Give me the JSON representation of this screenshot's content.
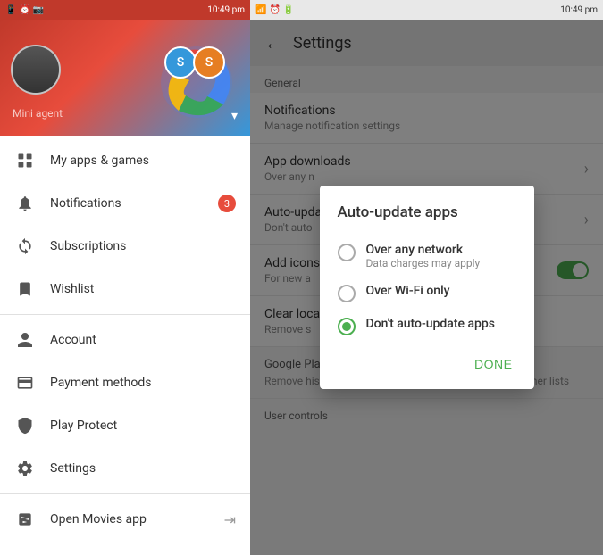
{
  "statusBar": {
    "left": {
      "time": "10:49 pm",
      "icons": [
        "signal",
        "wifi",
        "battery"
      ]
    },
    "right": {
      "time": "10:49 pm",
      "icons": [
        "signal",
        "wifi",
        "battery"
      ]
    }
  },
  "drawer": {
    "header": {
      "userName": "Mini agent",
      "initials1": "S",
      "initials2": "S"
    },
    "menu": [
      {
        "id": "my-apps",
        "label": "My apps & games",
        "icon": "grid"
      },
      {
        "id": "notifications",
        "label": "Notifications",
        "icon": "bell",
        "badge": "3"
      },
      {
        "id": "subscriptions",
        "label": "Subscriptions",
        "icon": "refresh"
      },
      {
        "id": "wishlist",
        "label": "Wishlist",
        "icon": "bookmark"
      },
      {
        "id": "account",
        "label": "Account",
        "icon": "person"
      },
      {
        "id": "payment",
        "label": "Payment methods",
        "icon": "credit-card"
      },
      {
        "id": "protect",
        "label": "Play Protect",
        "icon": "shield"
      },
      {
        "id": "settings",
        "label": "Settings",
        "icon": "settings"
      },
      {
        "id": "movies",
        "label": "Open Movies app",
        "icon": "film",
        "arrow": true
      }
    ]
  },
  "settings": {
    "title": "Settings",
    "sections": [
      {
        "label": "General",
        "items": [
          {
            "title": "Notifications",
            "subtitle": "Manage notification settings",
            "type": "arrow"
          },
          {
            "title": "App downloads",
            "subtitle": "Over any n",
            "type": "arrow"
          },
          {
            "title": "Auto-update apps",
            "subtitle": "Don't auto",
            "type": "arrow"
          },
          {
            "title": "Add icons",
            "subtitle": "For new a",
            "type": "toggle",
            "toggleOn": true
          },
          {
            "title": "Clear loca",
            "subtitle": "Remove s",
            "type": "text"
          }
        ]
      },
      {
        "label": "Google Play preferences",
        "labelFull": "Google Play preferences",
        "subtitle": "Remove history in your wishlist, the Beta program and other lists",
        "items": []
      },
      {
        "label": "User controls",
        "items": []
      }
    ]
  },
  "modal": {
    "title": "Auto-update apps",
    "options": [
      {
        "id": "over-any-network",
        "label": "Over any network",
        "sublabel": "Data charges may apply",
        "selected": false
      },
      {
        "id": "over-wifi-only",
        "label": "Over Wi-Fi only",
        "sublabel": "",
        "selected": false
      },
      {
        "id": "dont-auto-update",
        "label": "Don't auto-update apps",
        "sublabel": "",
        "selected": true
      }
    ],
    "doneLabel": "DONE"
  }
}
